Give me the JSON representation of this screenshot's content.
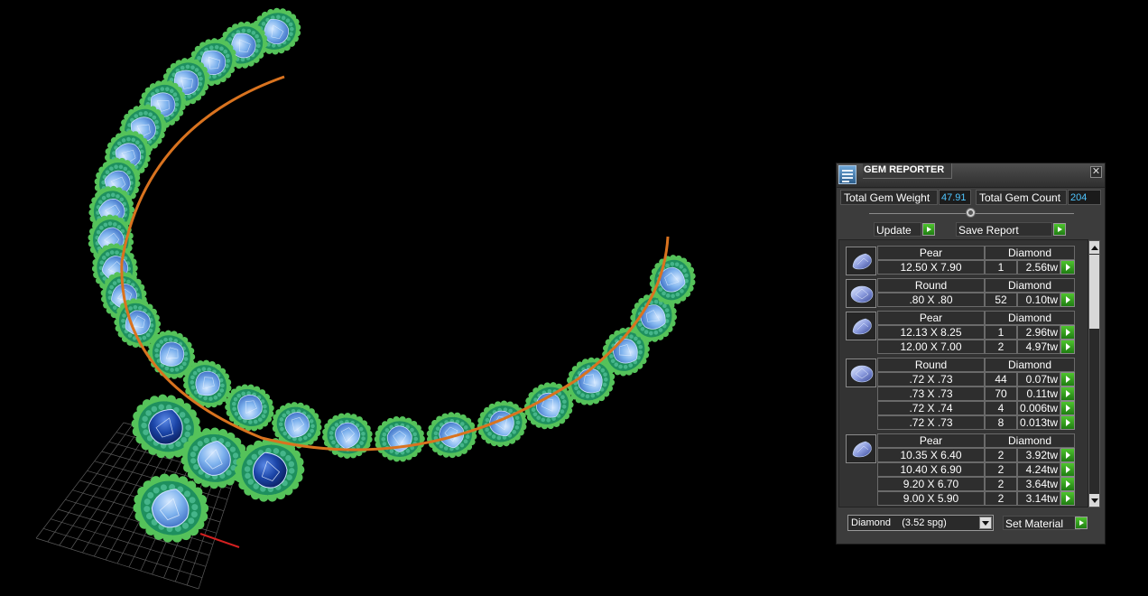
{
  "panel": {
    "title": "GEM REPORTER",
    "close_label": "✕",
    "icons": {
      "app": "gem-reporter-app-icon",
      "close": "close-icon",
      "gem": "gem-shape-icon",
      "go": "green-play-icon"
    },
    "colors": {
      "value_text": "#4fc6ff",
      "go_button": "#3aa321",
      "panel_bg": "#3c3c3c"
    }
  },
  "totals": {
    "weight_label": "Total Gem Weight",
    "weight_value": "47.91",
    "count_label": "Total Gem Count",
    "count_value": "204"
  },
  "actions": {
    "update_label": "Update",
    "save_label": "Save Report"
  },
  "groups": [
    {
      "shape": "Pear",
      "stone": "Diamond",
      "stone_color": "sapphire",
      "rows": [
        {
          "size": "12.50 X 7.90",
          "count": "1",
          "weight": "2.56tw"
        }
      ]
    },
    {
      "shape": "Round",
      "stone": "Diamond",
      "stone_color": "sapphire",
      "rows": [
        {
          "size": ".80 X .80",
          "count": "52",
          "weight": "0.10tw"
        }
      ]
    },
    {
      "shape": "Pear",
      "stone": "Diamond",
      "stone_color": "sapphire",
      "rows": [
        {
          "size": "12.13 X 8.25",
          "count": "1",
          "weight": "2.96tw"
        },
        {
          "size": "12.00 X 7.00",
          "count": "2",
          "weight": "4.97tw"
        }
      ]
    },
    {
      "shape": "Round",
      "stone": "Diamond",
      "stone_color": "sapphire",
      "rows": [
        {
          "size": ".72 X .73",
          "count": "44",
          "weight": "0.07tw"
        },
        {
          "size": ".73 X .73",
          "count": "70",
          "weight": "0.11tw"
        },
        {
          "size": ".72 X .74",
          "count": "4",
          "weight": "0.006tw"
        },
        {
          "size": ".72 X .73",
          "count": "8",
          "weight": "0.013tw"
        }
      ]
    },
    {
      "shape": "Pear",
      "stone": "Diamond",
      "stone_color": "sapphire",
      "rows": [
        {
          "size": "10.35 X 6.40",
          "count": "2",
          "weight": "3.92tw"
        },
        {
          "size": "10.40 X 6.90",
          "count": "2",
          "weight": "4.24tw"
        },
        {
          "size": "9.20 X 6.70",
          "count": "2",
          "weight": "3.64tw"
        },
        {
          "size": "9.00 X 5.90",
          "count": "2",
          "weight": "3.14tw"
        }
      ]
    }
  ],
  "material": {
    "selected": "Diamond    (3.52 spg)",
    "set_label": "Set Material"
  },
  "scene": {
    "description_icons": [
      "necklace-model",
      "ground-grid",
      "axis-x-red"
    ],
    "colors": {
      "gold_wire": "#d9731f",
      "prong_green": "#55c25a",
      "halo_teal": "#1e8f5e",
      "light_stone": "#7fb3ee",
      "dark_stone": "#1b45a8",
      "grid": "#5a5a5a"
    }
  }
}
